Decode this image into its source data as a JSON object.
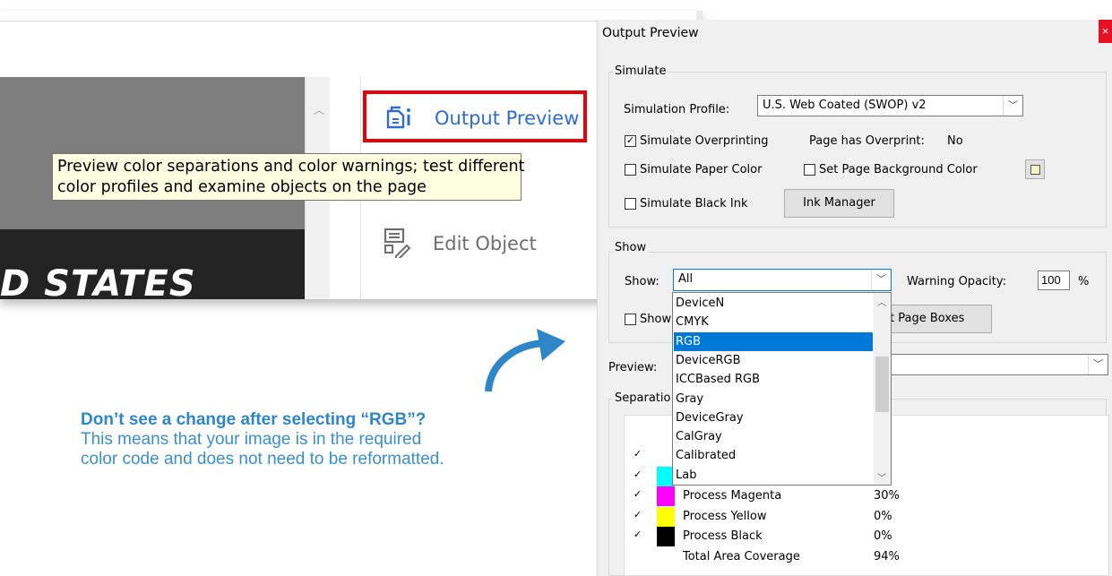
{
  "screenshot": {
    "tool_output_preview": "Output Preview",
    "tool_edit_object": "Edit Object",
    "tooltip_line1": "Preview color separations and color warnings; test different",
    "tooltip_line2": "color profiles and examine objects on the page",
    "document_text": "D STATES"
  },
  "annotation": {
    "heading": "Don’t see a change after selecting “RGB”?",
    "line1": "This means that your image is in the required",
    "line2": "color code and does not need to be reformatted.",
    "arrow_color": "#2e86c8"
  },
  "dialog": {
    "title": "Output Preview",
    "close": "×",
    "simulate": {
      "group_label": "Simulate",
      "profile_label": "Simulation Profile:",
      "profile_value": "U.S. Web Coated (SWOP) v2",
      "overprinting_label": "Simulate Overprinting",
      "overprinting_checked": true,
      "page_overprint_label": "Page has Overprint:",
      "page_overprint_value": "No",
      "paper_color_label": "Simulate Paper Color",
      "bg_color_label": "Set Page Background Color",
      "black_ink_label": "Simulate Black Ink",
      "ink_manager_label": "Ink Manager"
    },
    "show": {
      "group_label": "Show",
      "show_label": "Show:",
      "show_value": "All",
      "warning_opacity_label": "Warning Opacity:",
      "warning_opacity_value": "100",
      "percent": "%",
      "show_checkbox_label": "Show",
      "page_boxes_button": "et Page Boxes"
    },
    "preview_label": "Preview:",
    "separations_label": "Separatio",
    "dropdown_items": [
      "DeviceN",
      "CMYK",
      "RGB",
      "DeviceRGB",
      "ICCBased RGB",
      "Gray",
      "DeviceGray",
      "CalGray",
      "Calibrated",
      "Lab"
    ],
    "dropdown_selected": "RGB",
    "separations": [
      {
        "name": "",
        "percent": "",
        "color": "",
        "checked": true
      },
      {
        "name": "",
        "percent": "%",
        "color": "#00ffff",
        "checked": true
      },
      {
        "name": "Process Magenta",
        "percent": "30%",
        "color": "#ff00ff",
        "checked": true
      },
      {
        "name": "Process Yellow",
        "percent": "0%",
        "color": "#ffff00",
        "checked": true
      },
      {
        "name": "Process Black",
        "percent": "0%",
        "color": "#000000",
        "checked": true
      },
      {
        "name": "Total Area Coverage",
        "percent": "94%",
        "color": "",
        "checked": false
      }
    ]
  }
}
